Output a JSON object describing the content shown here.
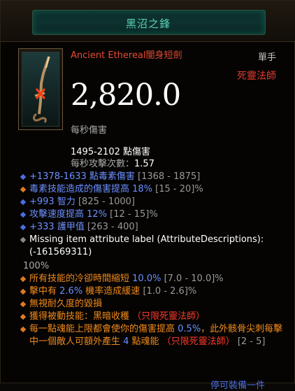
{
  "title": "黑沼之鋒",
  "item": {
    "icon": "dagger-icon",
    "name": "Ancient Ethereal闇身短劍",
    "slot": "單手",
    "class": "死靈法師",
    "dps": "2,820.0",
    "dps_label": "每秒傷害",
    "damage": "1495-2102 點傷害",
    "aps_label": "每秒攻擊次數：",
    "aps_value": "1.57"
  },
  "properties": [
    {
      "a": "+1378-1633 點毒素傷害",
      "b": " [1368 - 1875]"
    },
    {
      "a": "毒素技能造成的傷害提高 ",
      "v": "18%",
      "b": " [15 - 20]%"
    },
    {
      "a": "+993 智力",
      "b": " [825 - 1000]"
    },
    {
      "a": "攻擊速度提高 ",
      "v": "12%",
      "b": " [12 - 15]%"
    },
    {
      "a": "+333 護甲值",
      "b": " [263 - 400]"
    },
    {
      "a": "Missing item attribute label (AttributeDescriptions): (-161569311)"
    }
  ],
  "percent_line": "100%",
  "legendary": [
    {
      "a": "所有技能的冷卻時間縮短 ",
      "v": "10.0%",
      "b": " [7.0 - 10.0]%"
    },
    {
      "a": "擊中有 ",
      "v": "2.6%",
      "a2": " 機率造成緩速",
      "b": " [1.0 - 2.6]%"
    },
    {
      "a": "無視耐久度的毀損"
    },
    {
      "a": "獲得被動技能：黑暗收穫 ",
      "r": "（只限死靈法師）"
    },
    {
      "a": "每一點魂能上限都會使你的傷害提高 ",
      "v": "0.5%",
      "a2": "，此外骸骨尖刺每擊中一個敵人可額外產生 ",
      "v2": "4",
      "a3": " 點魂能 ",
      "r": "（只限死靈法師）",
      "b": " [2 - 5]"
    }
  ],
  "footer": "停可裝備一件"
}
